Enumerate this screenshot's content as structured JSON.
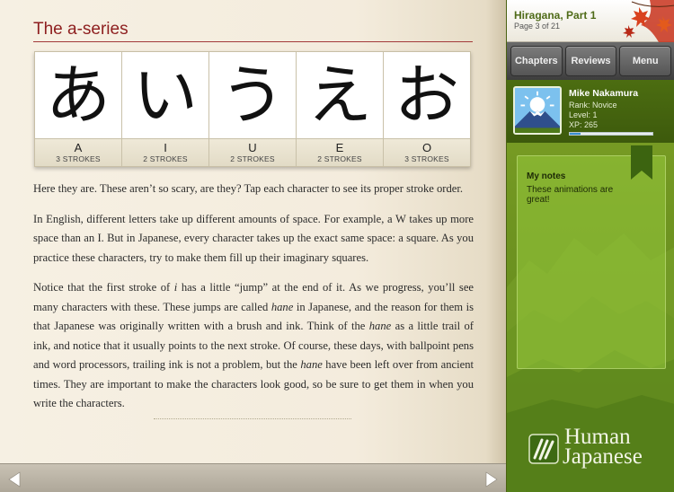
{
  "section": {
    "title": "The a-series"
  },
  "kana": [
    {
      "glyph": "あ",
      "roman": "A",
      "strokes": "3 STROKES"
    },
    {
      "glyph": "い",
      "roman": "I",
      "strokes": "2 STROKES"
    },
    {
      "glyph": "う",
      "roman": "U",
      "strokes": "2 STROKES"
    },
    {
      "glyph": "え",
      "roman": "E",
      "strokes": "2 STROKES"
    },
    {
      "glyph": "お",
      "roman": "O",
      "strokes": "3 STROKES"
    }
  ],
  "body": {
    "p1": "Here they are. These aren’t so scary, are they? Tap each character to see its proper stroke order.",
    "p2": "In English, different letters take up different amounts of space. For example, a W takes up more space than an I. But in Japanese, every character takes up the exact same space: a square. As you practice these characters, try to make them fill up their imaginary squares.",
    "p3": {
      "s1": "Notice that the first stroke of ",
      "i": "i",
      "s2": " has a little “jump” at the end of it. As we progress, you’ll see many characters with these. These jumps are called ",
      "hane1": "hane",
      "s3": " in Japanese, and the reason for them is that Japanese was originally written with a brush and ink. Think of the ",
      "hane2": "hane",
      "s4": " as a little trail of ink, and notice that it usually points to the next stroke. Of course, these days, with ballpoint pens and word processors, trailing ink is not a problem, but the ",
      "hane3": "hane",
      "s5": " have been left over from ancient times. They are important to make the characters look good, so be sure to get them in when you write the characters."
    }
  },
  "nav": {
    "prev_icon": "left-arrow-icon",
    "next_icon": "right-arrow-icon"
  },
  "lesson": {
    "title": "Hiragana, Part 1",
    "page": "Page 3 of 21"
  },
  "tabs": {
    "chapters": "Chapters",
    "reviews": "Reviews",
    "menu": "Menu"
  },
  "user": {
    "name": "Mike Nakamura",
    "rank": "Rank: Novice",
    "level": "Level: 1",
    "xp": "XP: 265",
    "xp_progress": 0.13
  },
  "notes": {
    "title": "My notes",
    "text": "These animations are great!"
  },
  "brand": {
    "line1": "Human",
    "line2": "Japanese"
  },
  "colors": {
    "title_red": "#8e1f1f",
    "sidebar_green": "#6f9420",
    "xp_blue": "#3a8fd2"
  }
}
